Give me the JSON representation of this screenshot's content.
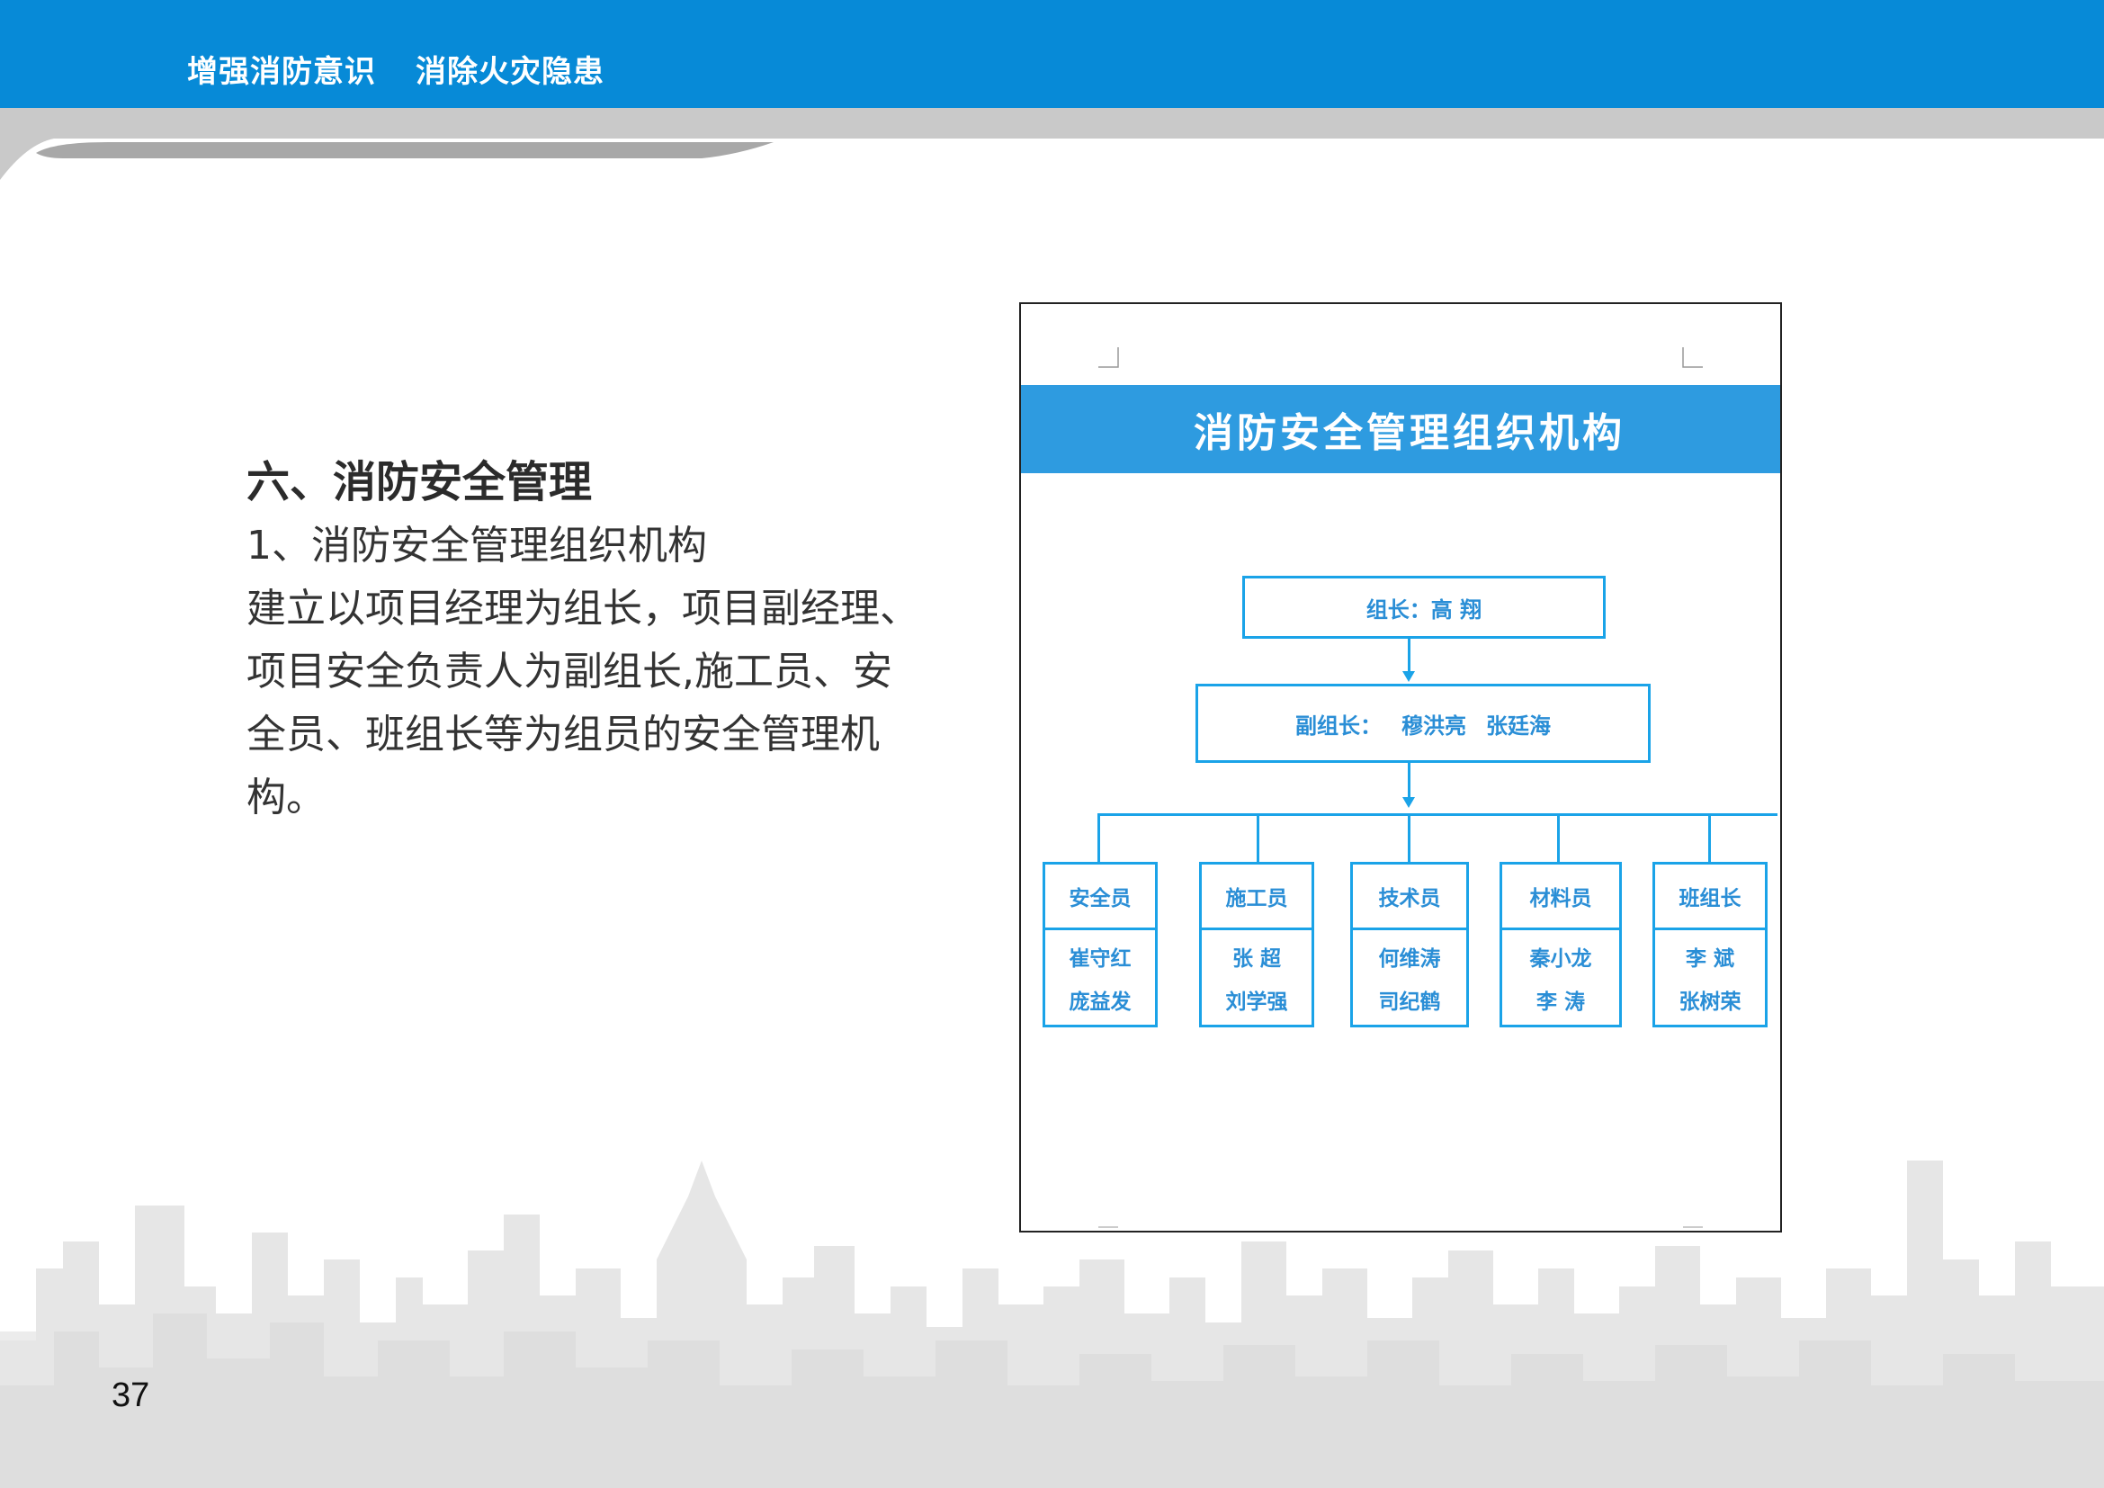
{
  "header": {
    "slogan_part1": "增强消防意识",
    "slogan_part2": "消除火灾隐患",
    "band_color": "#078ad7"
  },
  "content": {
    "section_title": "六、消防安全管理",
    "subsection_title": "1、消防安全管理组织机构",
    "body_lines": [
      "建立以项目经理为组长，项目副经理、",
      "项目安全负责人为副组长,施工员、安",
      "全员、班组长等为组员的安全管理机",
      "构。"
    ]
  },
  "document": {
    "banner_title": "消防安全管理组织机构",
    "leader": "组长：高  翔",
    "deputy_label": "副组长：",
    "deputies": [
      "穆洪亮",
      "张廷海"
    ],
    "members": [
      {
        "role": "安全员",
        "names": [
          "崔守红",
          "庞益发"
        ]
      },
      {
        "role": "施工员",
        "names": [
          "张  超",
          "刘学强"
        ]
      },
      {
        "role": "技术员",
        "names": [
          "何维涛",
          "司纪鹤"
        ]
      },
      {
        "role": "材料员",
        "names": [
          "秦小龙",
          "李  涛"
        ]
      },
      {
        "role": "班组长",
        "names": [
          "李  斌",
          "张树荣"
        ]
      }
    ],
    "accent_color": "#2e9be0"
  },
  "footer": {
    "page_number": "37"
  }
}
